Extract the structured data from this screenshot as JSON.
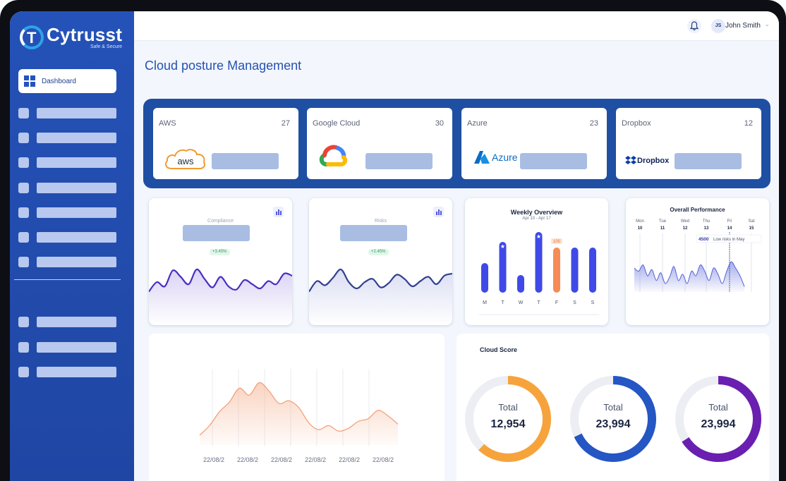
{
  "app": {
    "brand": "Cytrusst",
    "tagline": "Safe & Secure"
  },
  "sidebar": {
    "active_item": "Dashboard",
    "active_icon": "dashboard-grid-icon"
  },
  "header": {
    "user_initials": "JS",
    "user_name": "John Smith",
    "notification_icon": "bell-icon"
  },
  "page": {
    "title": "Cloud posture Management"
  },
  "providers": [
    {
      "name": "AWS",
      "count": "27",
      "logo_text": "aws"
    },
    {
      "name": "Google Cloud",
      "count": "30",
      "logo_text": ""
    },
    {
      "name": "Azure",
      "count": "23",
      "logo_text": "Azure"
    },
    {
      "name": "Dropbox",
      "count": "12",
      "logo_text": "Dropbox"
    }
  ],
  "compliance": {
    "title": "Compliance",
    "change": "+3.45%",
    "chart_data": {
      "type": "line",
      "x": [
        1,
        2,
        3,
        4,
        5,
        6,
        7,
        8,
        9,
        10,
        11,
        12,
        13,
        14,
        15,
        16,
        17,
        18,
        19
      ],
      "values": [
        30,
        48,
        40,
        70,
        58,
        44,
        72,
        54,
        38,
        58,
        40,
        34,
        52,
        44,
        36,
        50,
        44,
        64,
        60
      ]
    }
  },
  "risks": {
    "title": "Risks",
    "change": "+2.45%",
    "chart_data": {
      "type": "line",
      "x": [
        1,
        2,
        3,
        4,
        5,
        6,
        7,
        8,
        9,
        10,
        11,
        12,
        13,
        14,
        15,
        16,
        17,
        18,
        19
      ],
      "values": [
        30,
        50,
        42,
        56,
        72,
        48,
        36,
        48,
        54,
        38,
        46,
        62,
        54,
        40,
        50,
        58,
        44,
        60,
        64
      ]
    }
  },
  "weekly": {
    "title": "Weekly Overview",
    "subtitle": "Apr 10 - Apr 17",
    "highlight_label": "100",
    "colors": {
      "primary": "#3f49e8",
      "highlight": "#f58c55"
    },
    "chart_data": {
      "type": "bar",
      "categories": [
        "M",
        "T",
        "W",
        "T",
        "F",
        "S",
        "S"
      ],
      "values": [
        42,
        72,
        25,
        86,
        64,
        64,
        64
      ],
      "ylim": [
        0,
        90
      ],
      "starred": [
        1,
        3
      ],
      "highlight_index": 4
    }
  },
  "overall": {
    "title": "Overall Performance",
    "days": [
      "Mon",
      "Tue",
      "Wed",
      "Thu",
      "Fri",
      "Sat"
    ],
    "dates": [
      "10",
      "11",
      "12",
      "13",
      "14",
      "15"
    ],
    "tooltip_value": "4500",
    "tooltip_text": "Low risks in May",
    "chart_data": {
      "type": "area",
      "x": [
        1,
        2,
        3,
        4,
        5,
        6,
        7,
        8,
        9,
        10,
        11,
        12,
        13,
        14,
        15,
        16,
        17,
        18,
        19,
        20,
        21,
        22,
        23,
        24,
        25,
        26
      ],
      "values": [
        60,
        58,
        62,
        55,
        59,
        52,
        57,
        50,
        54,
        61,
        52,
        56,
        50,
        58,
        55,
        62,
        58,
        52,
        60,
        56,
        50,
        58,
        64,
        60,
        55,
        48
      ]
    }
  },
  "trend": {
    "x_labels": [
      "22/08/2",
      "22/08/2",
      "22/08/2",
      "22/08/2",
      "22/08/2",
      "22/08/2"
    ],
    "colors": {
      "line": "#f29b72"
    },
    "chart_data": {
      "type": "area",
      "x": [
        0,
        1,
        2,
        3,
        4,
        5,
        6,
        7,
        8,
        9,
        10,
        11,
        12,
        13,
        14,
        15,
        16,
        17,
        18,
        19,
        20
      ],
      "values": [
        4,
        18,
        38,
        52,
        72,
        62,
        80,
        68,
        50,
        54,
        44,
        22,
        12,
        18,
        10,
        14,
        24,
        28,
        40,
        32,
        20
      ],
      "ylim": [
        0,
        100
      ]
    }
  },
  "cloud_score": {
    "title": "Cloud Score",
    "items": [
      {
        "label": "Total",
        "value": "12,954",
        "fraction": 0.62,
        "color": "#f6a33b"
      },
      {
        "label": "Total",
        "value": "23,994",
        "fraction": 0.68,
        "color": "#2456c4"
      },
      {
        "label": "Total",
        "value": "23,994",
        "fraction": 0.66,
        "color": "#6a1fb0"
      }
    ]
  }
}
